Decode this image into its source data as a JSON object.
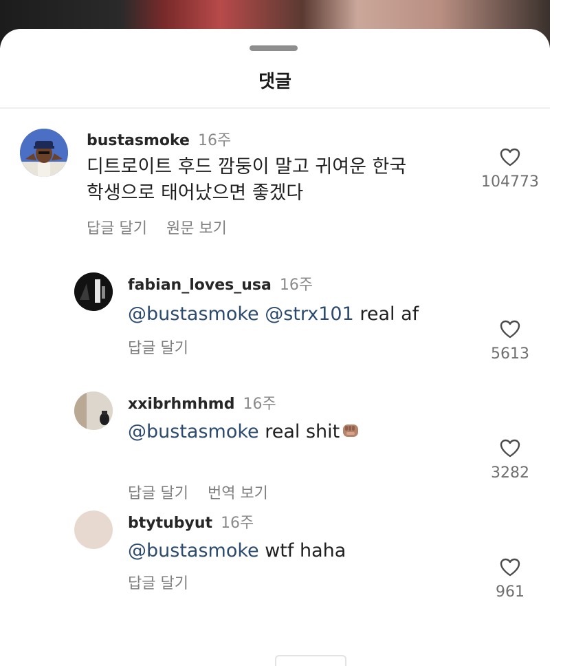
{
  "sheet": {
    "title": "댓글"
  },
  "comments": [
    {
      "username": "bustasmoke",
      "time": "16주",
      "text_line1": "디트로이트 후드 깜둥이 말고 귀여운 한국",
      "text_line2": "학생으로 태어났으면 좋겠다",
      "actions": [
        "답글 달기",
        "원문 보기"
      ],
      "likes": "104773"
    },
    {
      "username": "fabian_loves_usa",
      "time": "16주",
      "mention1": "@bustasmoke",
      "mention2": "@strx101",
      "text": "real af",
      "actions": [
        "답글 달기"
      ],
      "likes": "5613"
    },
    {
      "username": "xxibrhmhmd",
      "time": "16주",
      "mention1": "@bustasmoke",
      "text": "real shit",
      "emoji": "fist-emoji",
      "actions": [
        "답글 달기",
        "번역 보기"
      ],
      "likes": "3282"
    },
    {
      "username": "btytubyut",
      "time": "16주",
      "mention1": "@bustasmoke",
      "text": "wtf haha",
      "actions": [
        "답글 달기"
      ],
      "likes": "961"
    }
  ],
  "icons": {
    "like": "heart-outline-icon"
  },
  "colors": {
    "mention": "#2c4a6e",
    "secondary_text": "#8a8a8a",
    "background": "#ffffff"
  }
}
